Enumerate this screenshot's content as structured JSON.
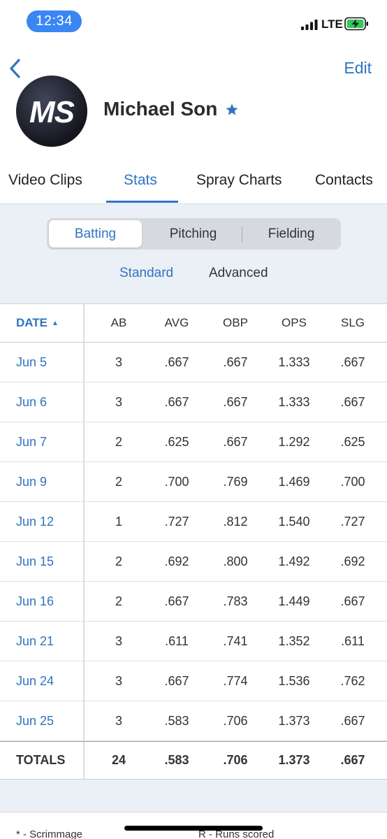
{
  "status_bar": {
    "time": "12:34",
    "network": "LTE"
  },
  "nav": {
    "edit_label": "Edit"
  },
  "profile": {
    "initials": "MS",
    "name": "Michael Son"
  },
  "tabs": [
    "Video Clips",
    "Stats",
    "Spray Charts",
    "Contacts"
  ],
  "segments": [
    "Batting",
    "Pitching",
    "Fielding"
  ],
  "sub_tabs": [
    "Standard",
    "Advanced"
  ],
  "table": {
    "headers": {
      "date": "DATE",
      "sort_indicator": "▲",
      "ab": "AB",
      "avg": "AVG",
      "obp": "OBP",
      "ops": "OPS",
      "slg": "SLG"
    },
    "rows": [
      {
        "date": "Jun 5",
        "ab": "3",
        "avg": ".667",
        "obp": ".667",
        "ops": "1.333",
        "slg": ".667"
      },
      {
        "date": "Jun 6",
        "ab": "3",
        "avg": ".667",
        "obp": ".667",
        "ops": "1.333",
        "slg": ".667"
      },
      {
        "date": "Jun 7",
        "ab": "2",
        "avg": ".625",
        "obp": ".667",
        "ops": "1.292",
        "slg": ".625"
      },
      {
        "date": "Jun 9",
        "ab": "2",
        "avg": ".700",
        "obp": ".769",
        "ops": "1.469",
        "slg": ".700"
      },
      {
        "date": "Jun 12",
        "ab": "1",
        "avg": ".727",
        "obp": ".812",
        "ops": "1.540",
        "slg": ".727"
      },
      {
        "date": "Jun 15",
        "ab": "2",
        "avg": ".692",
        "obp": ".800",
        "ops": "1.492",
        "slg": ".692"
      },
      {
        "date": "Jun 16",
        "ab": "2",
        "avg": ".667",
        "obp": ".783",
        "ops": "1.449",
        "slg": ".667"
      },
      {
        "date": "Jun 21",
        "ab": "3",
        "avg": ".611",
        "obp": ".741",
        "ops": "1.352",
        "slg": ".611"
      },
      {
        "date": "Jun 24",
        "ab": "3",
        "avg": ".667",
        "obp": ".774",
        "ops": "1.536",
        "slg": ".762"
      },
      {
        "date": "Jun 25",
        "ab": "3",
        "avg": ".583",
        "obp": ".706",
        "ops": "1.373",
        "slg": ".667"
      }
    ],
    "totals": {
      "label": "TOTALS",
      "ab": "24",
      "avg": ".583",
      "obp": ".706",
      "ops": "1.373",
      "slg": ".667"
    }
  },
  "legend": {
    "scrimmage": "* - Scrimmage",
    "runs_scored": "R - Runs scored"
  },
  "colors": {
    "accent": "#2f74c0",
    "time_pill": "#3a86f3",
    "battery_green": "#34c759",
    "panel_bg": "#ebf0f7"
  },
  "icons": {
    "back": "chevron-left-icon",
    "star": "star-icon",
    "signal": "signal-bars-icon",
    "battery": "battery-charging-icon"
  }
}
